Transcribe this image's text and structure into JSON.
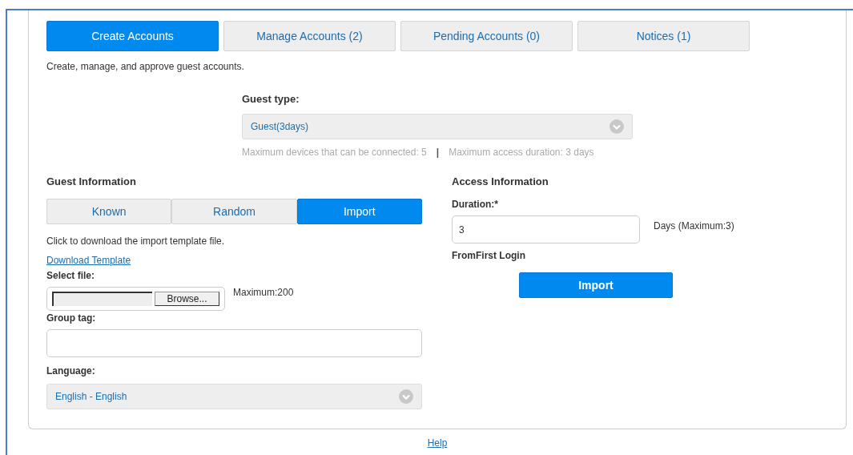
{
  "tabs": [
    {
      "label": "Create Accounts",
      "selected": true
    },
    {
      "label": "Manage Accounts (2)",
      "selected": false
    },
    {
      "label": "Pending Accounts (0)",
      "selected": false
    },
    {
      "label": "Notices (1)",
      "selected": false
    }
  ],
  "description": "Create, manage, and approve guest accounts.",
  "guest_type": {
    "label": "Guest type:",
    "value": "Guest(3days)",
    "hint_devices": "Maximum devices that can be connected: 5",
    "separator": "|",
    "hint_duration": "Maximum access duration: 3 days"
  },
  "guest_information": {
    "heading": "Guest Information",
    "modes": [
      {
        "label": "Known",
        "selected": false
      },
      {
        "label": "Random",
        "selected": false
      },
      {
        "label": "Import",
        "selected": true
      }
    ],
    "instruction": "Click to download the import template file.",
    "download_link": "Download Template",
    "select_file": {
      "label": "Select file:",
      "button": "Browse...",
      "note": "Maximum:200"
    },
    "group_tag": {
      "label": "Group tag:"
    },
    "language": {
      "label": "Language:",
      "value": "English - English"
    }
  },
  "access_information": {
    "heading": "Access Information",
    "duration_label": "Duration:*",
    "duration_value": "3",
    "duration_note": "Days (Maximum:3)",
    "start": "FromFirst Login",
    "submit": "Import"
  },
  "footer_link": "Help"
}
